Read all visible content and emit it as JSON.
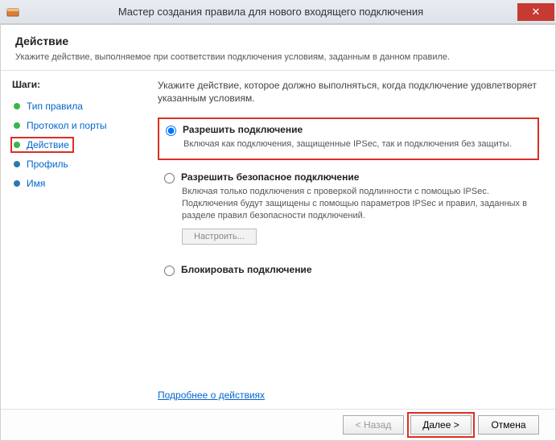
{
  "titlebar": {
    "title": "Мастер создания правила для нового входящего подключения",
    "close": "✕"
  },
  "header": {
    "title": "Действие",
    "subtitle": "Укажите действие, выполняемое при соответствии подключения условиям, заданным в данном правиле."
  },
  "sidebar": {
    "title": "Шаги:",
    "steps": [
      {
        "label": "Тип правила"
      },
      {
        "label": "Протокол и порты"
      },
      {
        "label": "Действие"
      },
      {
        "label": "Профиль"
      },
      {
        "label": "Имя"
      }
    ]
  },
  "main": {
    "intro": "Укажите действие, которое должно выполняться, когда подключение удовлетворяет указанным условиям.",
    "options": {
      "allow": {
        "title": "Разрешить подключение",
        "desc": "Включая как подключения, защищенные IPSec, так и подключения без защиты."
      },
      "allow_secure": {
        "title": "Разрешить безопасное подключение",
        "desc": "Включая только подключения с проверкой подлинности с помощью IPSec. Подключения будут защищены с помощью параметров IPSec и правил, заданных в разделе правил безопасности подключений.",
        "config_btn": "Настроить..."
      },
      "block": {
        "title": "Блокировать подключение"
      }
    },
    "learn_more": "Подробнее о действиях"
  },
  "footer": {
    "back": "< Назад",
    "next": "Далее >",
    "cancel": "Отмена"
  }
}
